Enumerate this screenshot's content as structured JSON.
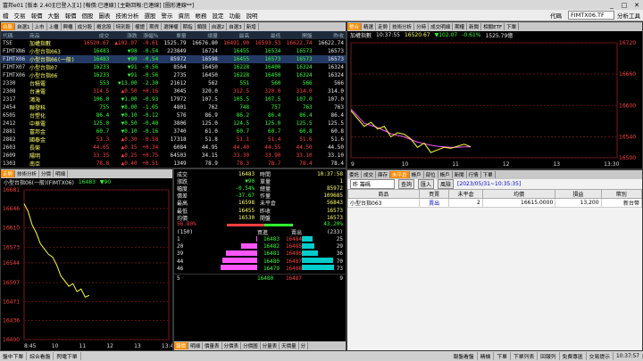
{
  "window": {
    "title": "富邦e01 [版本 2.40][已登入][1] [報價:已連線] [主動回報:已連線] [圖形連線**]"
  },
  "menu": {
    "items": [
      "檔",
      "交易",
      "報價",
      "大盤",
      "報價",
      "個股",
      "圖表",
      "技術分析",
      "選股",
      "警示",
      "資訊",
      "帳務",
      "設定",
      "功能",
      "說明"
    ],
    "code_label": "代碼",
    "code_value": "FIMTX06.TF",
    "analysis": "分析工具"
  },
  "quote": {
    "tabs": [
      "台股",
      "自選1",
      "上市",
      "上櫃",
      "興櫃",
      "成分股",
      "概念股",
      "特別股",
      "權證",
      "期貨",
      "選擇權",
      "期指",
      "類股",
      "自選2",
      "自選3",
      "新增"
    ],
    "columns": [
      "代碼",
      "商品",
      "成交",
      "漲跌",
      "漲幅%",
      "單量",
      "總量",
      "最高",
      "最低",
      "開盤",
      "昨收"
    ],
    "rows": [
      [
        "TSE",
        "加權指數",
        "16520.67",
        "▲102.07",
        "-0.61",
        "1525.79",
        "16676.80",
        "16491.90",
        "16593.53",
        "16622.74"
      ],
      [
        "FIMTXN6",
        "小型台指063",
        "16483",
        "▼98",
        "-0.54",
        "223849",
        "16724",
        "16455",
        "16534",
        "16573"
      ],
      [
        "FIMTX06",
        "小型台指06(一般)",
        "16483",
        "▼90",
        "-0.54",
        "85972",
        "16598",
        "16455",
        "16573",
        "16573"
      ],
      [
        "FIMTX07",
        "小型台指07",
        "16233",
        "▼91",
        "-0.56",
        "8564",
        "16450",
        "16228",
        "16400",
        "16324"
      ],
      [
        "FIMTX06",
        "小型台指06",
        "16233",
        "▼91",
        "-0.56",
        "2735",
        "16450",
        "16228",
        "16450",
        "16324"
      ],
      [
        "2330",
        "台積電",
        "553",
        "▼13.00",
        "-2.30",
        "21612",
        "562",
        "551",
        "560",
        "566"
      ],
      [
        "2308",
        "台達電",
        "314.5",
        "▲0.50",
        "+0.16",
        "3045",
        "320.0",
        "312.5",
        "320.0",
        "314.0"
      ],
      [
        "2317",
        "鴻海",
        "106.0",
        "▼1.00",
        "-0.93",
        "17972",
        "107.5",
        "105.5",
        "107.5",
        "107.0"
      ],
      [
        "2454",
        "聯發科",
        "755",
        "▼8.00",
        "-1.05",
        "4801",
        "762",
        "748",
        "757",
        "763"
      ],
      [
        "6505",
        "台塑化",
        "86.4",
        "▼0.10",
        "-0.12",
        "576",
        "86.9",
        "86.2",
        "86.4",
        "86.4"
      ],
      [
        "2412",
        "中華電",
        "125.0",
        "▼0.50",
        "-0.40",
        "3806",
        "125.0",
        "124.5",
        "125.0",
        "125.5"
      ],
      [
        "2881",
        "富邦金",
        "60.7",
        "▼0.10",
        "-0.16",
        "3740",
        "61.0",
        "60.7",
        "60.7",
        "60.8"
      ],
      [
        "2882",
        "國泰金",
        "51.3",
        "▲0.30",
        "-0.58",
        "17318",
        "51.8",
        "51.1",
        "51.4",
        "51.6"
      ],
      [
        "2603",
        "長榮",
        "44.65",
        "▲0.15",
        "+0.34",
        "6084",
        "44.95",
        "44.40",
        "44.55",
        "44.50"
      ],
      [
        "2609",
        "陽明",
        "33.35",
        "▲0.25",
        "+0.75",
        "64503",
        "34.15",
        "33.30",
        "33.90",
        "33.10"
      ],
      [
        "1303",
        "南亞",
        "78.8",
        "▲0.40",
        "+0.51",
        "1349",
        "78.9",
        "78.3",
        "78.7",
        "78.4"
      ],
      [
        "2886",
        "兆豐金",
        "93.0",
        "▲0.90",
        "+0.97",
        "1829",
        "94.0",
        "93.1",
        "93.1",
        "95.5"
      ],
      [
        "2002",
        "中鋼",
        "29.25",
        "▲0.25",
        "+0.86",
        "7073",
        "29.40",
        "29.00",
        "29.05",
        "29.00"
      ]
    ]
  },
  "minute": {
    "tabs": [
      "整合",
      "精選",
      "走勢",
      "技術分析",
      "分時",
      "成交明細",
      "期權",
      "新聞",
      "相關ETF",
      "下單"
    ],
    "name": "加權指數",
    "time": "10:37:55",
    "price": "16520.67",
    "chg": "▼102.07",
    "pct": "-0.61%",
    "vol": "1525.79億",
    "yticks": [
      "16720",
      "16660",
      "16600",
      "16540",
      "16500"
    ],
    "xticks": [
      "9",
      "10",
      "11",
      "12",
      "13",
      "13:30"
    ],
    "series": [
      16590,
      16575,
      16560,
      16568,
      16555,
      16560,
      16540,
      16548,
      16545,
      16536,
      16520,
      16528,
      16510,
      16515,
      16520,
      16518,
      16522,
      16526,
      16521
    ],
    "series2": [
      16593,
      16580,
      16566,
      16562,
      16558,
      16552,
      16546,
      16543,
      16540,
      16535,
      16530,
      16527,
      16524,
      16522,
      16521,
      16520,
      16520,
      16521,
      16521
    ]
  },
  "tick": {
    "tabs": [
      "走勢",
      "技術分析",
      "分價",
      "明細"
    ],
    "name": "小型台指06(一般)(FIMTX06)",
    "price": "16483",
    "chg": "▼90",
    "yticks": [
      "16681",
      "16646",
      "16610",
      "16573",
      "16544",
      "16507",
      "16471",
      "16436",
      "16400"
    ],
    "xticks": [
      "8:45",
      "10",
      "11",
      "12",
      "13",
      "13:45"
    ],
    "series": [
      16655,
      16640,
      16615,
      16600,
      16580,
      16570,
      16560,
      16555,
      16540,
      16520,
      16510,
      16500,
      16505,
      16490,
      16495,
      16480,
      16483
    ]
  },
  "detail": {
    "labels": [
      "成交",
      "漲跌",
      "幅度",
      "價差",
      "最高",
      "最低",
      "均價"
    ],
    "values": [
      "16483",
      "▼90",
      "-0.54%",
      "-37.67",
      "16598",
      "16455",
      "16530"
    ],
    "labels2": [
      "時間",
      "單量",
      "總量",
      "作量",
      "未平倉",
      "昨收",
      "開盤"
    ],
    "values2": [
      "10:37:58",
      "1",
      "85972",
      "109685",
      "56843",
      "16573",
      "16573"
    ],
    "buy_pct": "56.80%",
    "sell_pct": "43.20%",
    "buy_total": "(150)",
    "sell_total": "(233)",
    "bid_head": "買進",
    "ask_head": "賣出",
    "book": [
      {
        "bq": "1",
        "bp": "16483",
        "ap": "16484",
        "aq": "25"
      },
      {
        "bq": "20",
        "bp": "16482",
        "ap": "16485",
        "aq": "29"
      },
      {
        "bq": "39",
        "bp": "16481",
        "ap": "16486",
        "aq": "36"
      },
      {
        "bq": "44",
        "bp": "16480",
        "ap": "16487",
        "aq": "70"
      },
      {
        "bq": "46",
        "bp": "16479",
        "ap": "16488",
        "aq": "73"
      }
    ],
    "bottom": {
      "l": "5",
      "bp": "16480",
      "ap": "16487",
      "r": "9"
    },
    "bottom_tabs": [
      "報價",
      "明細",
      "價量表",
      "分價表",
      "分價圖",
      "分量表",
      "天價量",
      "分"
    ]
  },
  "orders": {
    "tabs": [
      "委託",
      "成交",
      "庫存",
      "未平倉",
      "帳戶",
      "部位",
      "帳戶",
      "新聞",
      "行情",
      "下單"
    ],
    "filter": "昨 籌碼",
    "query_btn": "查詢",
    "collapse_btn": "匯入",
    "settings_btn": "風險",
    "date": "[2023/05/31~10:35:35]",
    "columns": [
      "商品",
      "買賣",
      "未平倉",
      "均價",
      "損益",
      "幣別"
    ],
    "rows": [
      [
        "小型台指063",
        "賣出",
        "2",
        "16615.0000",
        "13,200",
        "新台幣"
      ]
    ]
  },
  "status": {
    "items": [
      "盤中下單",
      "綜合看盤",
      "閃電下單"
    ],
    "right": [
      "報盤看盤",
      "精機",
      "下單",
      "下單列表",
      "回報列",
      "免費專區",
      "交易提示",
      "10:37:57"
    ]
  },
  "colors": {
    "up": "#ff4040",
    "down": "#33ff33",
    "accent": "#ff8c00"
  }
}
